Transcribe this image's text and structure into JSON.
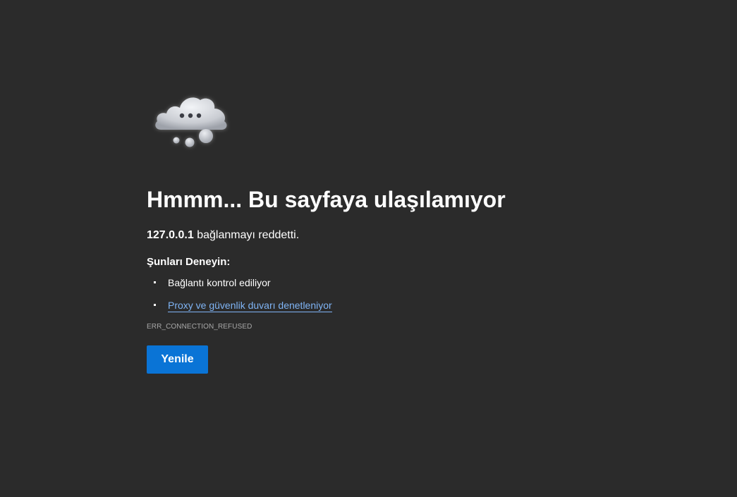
{
  "error": {
    "icon": "cloud-thinking-icon",
    "title": "Hmmm... Bu sayfaya ulaşılamıyor",
    "host": "127.0.0.1",
    "message": "bağlanmayı reddetti.",
    "try_heading": "Şunları Deneyin:",
    "suggestions": [
      {
        "text": "Bağlantı kontrol ediliyor",
        "is_link": false
      },
      {
        "text": "Proxy ve güvenlik duvarı denetleniyor",
        "is_link": true
      }
    ],
    "code": "ERR_CONNECTION_REFUSED",
    "reload_label": "Yenile"
  },
  "colors": {
    "background": "#2b2b2b",
    "accent_button": "#0a74d6",
    "link": "#7fb4f5",
    "muted_text": "#a8a8a8"
  }
}
